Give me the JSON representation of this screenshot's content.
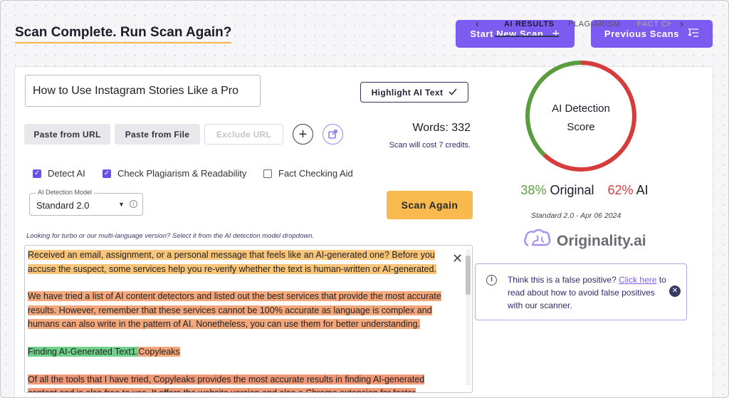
{
  "header": {
    "title": "Scan Complete. Run Scan Again?",
    "start_new_scan": "Start New Scan",
    "previous_scans": "Previous Scans"
  },
  "editor": {
    "title_value": "How to Use Instagram Stories Like a Pro",
    "highlight_label": "Highlight AI Text",
    "paste_url": "Paste from URL",
    "paste_file": "Paste from File",
    "exclude_url_placeholder": "Exclude URL",
    "words_label": "Words: 332",
    "cost_text": "Scan will cost 7 credits.",
    "checks": [
      {
        "label": "Detect AI",
        "checked": true
      },
      {
        "label": "Check Plagiarism & Readability",
        "checked": true
      },
      {
        "label": "Fact Checking Aid",
        "checked": false
      }
    ],
    "model_legend": "AI Detection Model",
    "model_value": "Standard 2.0",
    "scan_again": "Scan Again",
    "hint": "Looking for turbo or our multi-language version? Select it from the AI detection model dropdown.",
    "paragraphs": [
      "Received an email, assignment, or a personal message that feels like an AI-generated one? Before you accuse the suspect, some services help you re-verify whether the text is human-written or AI-generated.",
      "We have tried a list of AI content detectors and listed out the best services that provide the most accurate results. However, remember that these services cannot be 100% accurate as language is complex and humans can also write in the pattern of AI. Nonetheless, you can use them for better understanding.",
      "Finding AI-Generated Text1.",
      "Copyleaks",
      "Of all the tools that I have tried, Copyleaks provides the most accurate results in finding AI-generated content and is also free to use. It offers the website version and also a Chrome extension for faster"
    ]
  },
  "results": {
    "tabs": [
      "AI RESULTS",
      "PLAGIARISM",
      "FACT CHECK"
    ],
    "gauge_label_line1": "AI Detection",
    "gauge_label_line2": "Score",
    "original_pct": "38%",
    "original_label": "Original",
    "ai_pct": "62%",
    "ai_label": "AI",
    "original_fraction": 0.38,
    "ai_fraction": 0.62,
    "model_date": "Standard 2.0 - Apr 06 2024",
    "logo_text": "Originality.ai",
    "false_positive": {
      "prefix": "Think this is a false positive? ",
      "link": "Click here",
      "suffix": " to read about how to avoid false positives with our scanner."
    }
  },
  "colors": {
    "accent": "#7c5cf0",
    "scan_button": "#f8b94e",
    "original_green": "#5a9d3f",
    "ai_red": "#d63c3c"
  }
}
